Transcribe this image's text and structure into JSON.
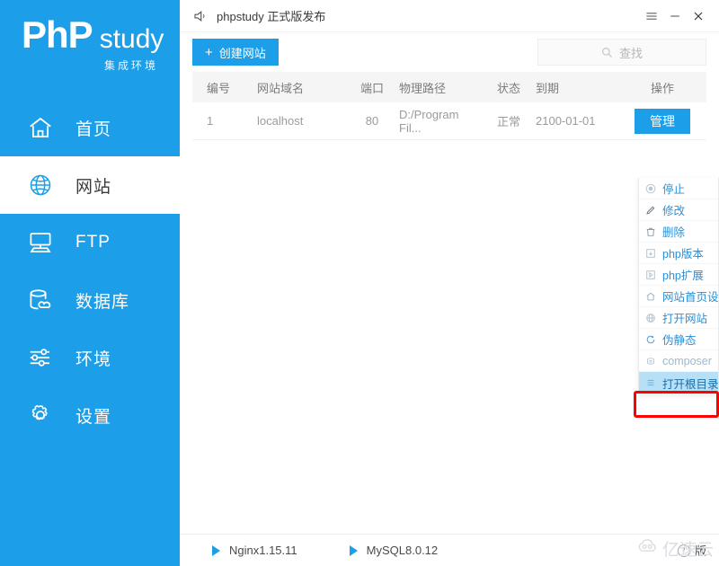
{
  "sidebar": {
    "logo": {
      "main": "PhP",
      "accent": "study",
      "subtitle": "集成环境"
    },
    "brand_color": "#1c9fe8",
    "items": [
      {
        "label": "首页",
        "icon": "home-icon",
        "active": false
      },
      {
        "label": "网站",
        "icon": "globe-icon",
        "active": true
      },
      {
        "label": "FTP",
        "icon": "ftp-icon",
        "active": false
      },
      {
        "label": "数据库",
        "icon": "database-icon",
        "active": false
      },
      {
        "label": "环境",
        "icon": "sliders-icon",
        "active": false
      },
      {
        "label": "设置",
        "icon": "gear-icon",
        "active": false
      }
    ]
  },
  "titlebar": {
    "icon": "speaker-icon",
    "title": "phpstudy 正式版发布",
    "menu_icon": "hamburger-icon",
    "minimize_icon": "minimize-icon",
    "close_icon": "close-icon"
  },
  "toolbar": {
    "create_label": "创建网站",
    "create_plus": "+",
    "search_placeholder": "查找",
    "search_icon": "search-icon"
  },
  "table": {
    "headers": [
      "编号",
      "网站域名",
      "端口",
      "物理路径",
      "状态",
      "到期",
      "操作"
    ],
    "rows": [
      {
        "id": "1",
        "domain": "localhost",
        "port": "80",
        "path": "D:/Program Fil...",
        "status": "正常",
        "expire": "2100-01-01",
        "action_label": "管理"
      }
    ]
  },
  "dropdown": {
    "items": [
      {
        "label": "停止",
        "icon": "stop-circle-icon",
        "state": "normal"
      },
      {
        "label": "修改",
        "icon": "pencil-icon",
        "state": "normal"
      },
      {
        "label": "删除",
        "icon": "trash-icon",
        "state": "normal"
      },
      {
        "label": "php版本",
        "icon": "php-version-icon",
        "state": "normal"
      },
      {
        "label": "php扩展",
        "icon": "php-extension-icon",
        "state": "normal"
      },
      {
        "label": "网站首页设置",
        "icon": "house-icon",
        "state": "normal"
      },
      {
        "label": "打开网站",
        "icon": "globe-small-icon",
        "state": "normal"
      },
      {
        "label": "伪静态",
        "icon": "refresh-icon",
        "state": "normal"
      },
      {
        "label": "composer",
        "icon": "composer-icon",
        "state": "disabled"
      },
      {
        "label": "打开根目录",
        "icon": "folder-list-icon",
        "state": "highlighted"
      }
    ],
    "highlight_color": "#b7e0f7",
    "annotation_color": "#fe0000"
  },
  "footer": {
    "services": [
      {
        "label": "Nginx1.15.11",
        "icon": "play-icon"
      },
      {
        "label": "MySQL8.0.12",
        "icon": "play-icon"
      }
    ],
    "info_icon": "info-icon",
    "version_text": "版"
  },
  "watermark": {
    "text": "亿速云",
    "icon": "cloud-icon"
  }
}
